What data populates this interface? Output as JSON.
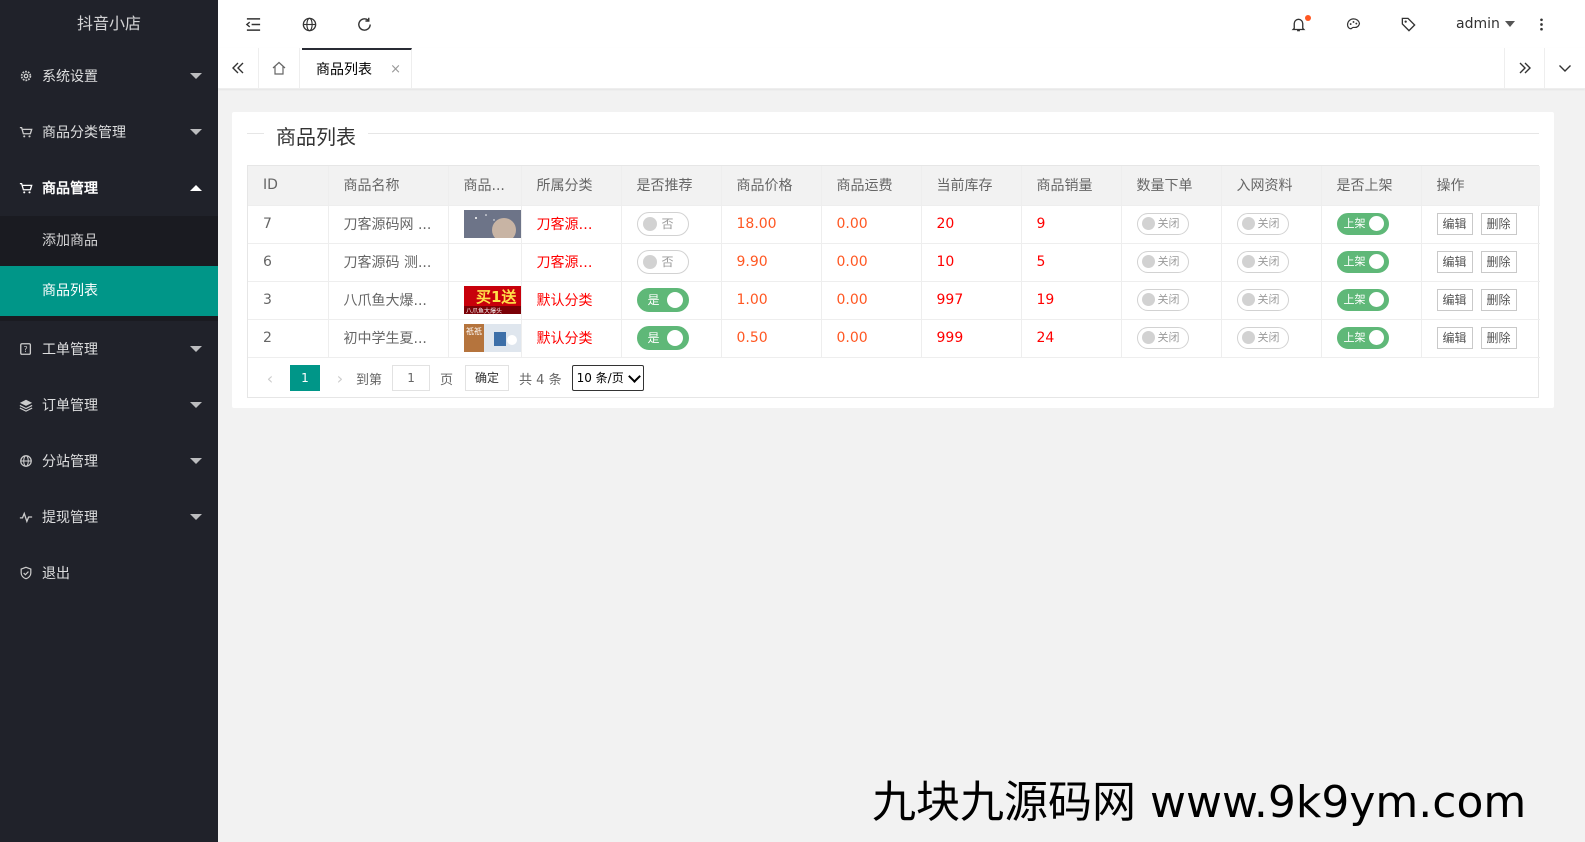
{
  "app": {
    "title": "抖音小店"
  },
  "sidebar": {
    "items": [
      {
        "label": "系统设置",
        "icon": "gear-icon"
      },
      {
        "label": "商品分类管理",
        "icon": "cart-icon"
      },
      {
        "label": "商品管理",
        "icon": "cart-icon",
        "open": true,
        "children": [
          {
            "label": "添加商品"
          },
          {
            "label": "商品列表",
            "active": true
          }
        ]
      },
      {
        "label": "工单管理",
        "icon": "help-icon"
      },
      {
        "label": "订单管理",
        "icon": "layers-icon"
      },
      {
        "label": "分站管理",
        "icon": "globe-icon"
      },
      {
        "label": "提现管理",
        "icon": "pulse-icon"
      },
      {
        "label": "退出",
        "icon": "shield-icon"
      }
    ]
  },
  "header": {
    "user": "admin",
    "icons": [
      "menu-collapse-icon",
      "globe-icon",
      "refresh-icon",
      "bell-icon",
      "theme-icon",
      "tag-icon",
      "more-icon"
    ]
  },
  "tabs": {
    "active": "商品列表",
    "close": "×"
  },
  "card": {
    "title": "商品列表"
  },
  "table": {
    "columns": [
      "ID",
      "商品名称",
      "商品...",
      "所属分类",
      "是否推荐",
      "商品价格",
      "商品运费",
      "当前库存",
      "商品销量",
      "数量下单",
      "入网资料",
      "是否上架",
      "操作"
    ],
    "rows": [
      {
        "id": "7",
        "name": "刀客源码网 ...",
        "category": "刀客源码网",
        "recommend": "否",
        "recommend_on": false,
        "price": "18.00",
        "freight": "0.00",
        "stock": "20",
        "sales": "9",
        "qty_order": "关闭",
        "netinfo": "关闭",
        "listed": "上架"
      },
      {
        "id": "6",
        "name": "刀客源码 测...",
        "category": "刀客源码网",
        "recommend": "否",
        "recommend_on": false,
        "price": "9.90",
        "freight": "0.00",
        "stock": "10",
        "sales": "5",
        "qty_order": "关闭",
        "netinfo": "关闭",
        "listed": "上架"
      },
      {
        "id": "3",
        "name": "八爪鱼大爆...",
        "category": "默认分类",
        "recommend": "是",
        "recommend_on": true,
        "price": "1.00",
        "freight": "0.00",
        "stock": "997",
        "sales": "19",
        "qty_order": "关闭",
        "netinfo": "关闭",
        "listed": "上架"
      },
      {
        "id": "2",
        "name": "初中学生夏...",
        "category": "默认分类",
        "recommend": "是",
        "recommend_on": true,
        "price": "0.50",
        "freight": "0.00",
        "stock": "999",
        "sales": "24",
        "qty_order": "关闭",
        "netinfo": "关闭",
        "listed": "上架"
      }
    ],
    "actions": {
      "edit": "编辑",
      "delete": "删除"
    },
    "thumb_text": {
      "row3": "买1送",
      "row3_sub": "八爪鱼大爆头",
      "row4": "祇祇"
    }
  },
  "pagination": {
    "current": "1",
    "goto_label": "到第",
    "goto_value": "1",
    "page_unit": "页",
    "confirm": "确定",
    "total": "共 4 条",
    "page_size": "10 条/页"
  },
  "watermark": "九块九源码网 www.9k9ym.com",
  "colors": {
    "sidebar": "#20222a",
    "accent": "#009688",
    "switch_on": "#5fb878",
    "value_red": "#ff0000",
    "value_orange": "#ff5722"
  }
}
